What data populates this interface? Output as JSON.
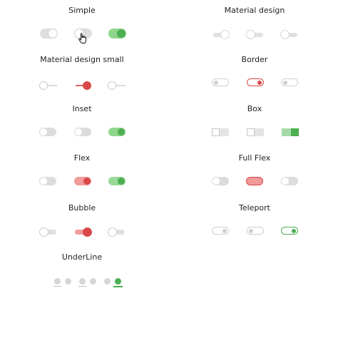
{
  "sections": {
    "simple": "Simple",
    "material_design": "Material design",
    "material_design_small": "Material design small",
    "border": "Border",
    "inset": "Inset",
    "box": "Box",
    "flex": "Flex",
    "full_flex": "Full Flex",
    "bubble": "Bubble",
    "teleport": "Teleport",
    "underline": "UnderLine"
  },
  "colors": {
    "active_green": "#4caf50",
    "active_red": "#d94848",
    "off_gray": "#dcdcdc"
  },
  "icons": {
    "pointer": "hand-pointer-cursor-icon"
  }
}
